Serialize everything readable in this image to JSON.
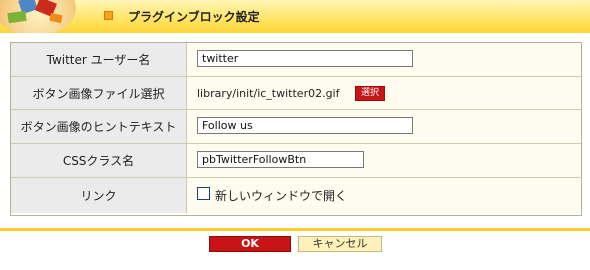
{
  "header": {
    "title": "プラグインブロック設定"
  },
  "form": {
    "rows": [
      {
        "label": "Twitter ユーザー名",
        "value": "twitter"
      },
      {
        "label": "ボタン画像ファイル選択",
        "value": "library/init/ic_twitter02.gif",
        "select_label": "選択"
      },
      {
        "label": "ボタン画像のヒントテキスト",
        "value": "Follow us"
      },
      {
        "label": "CSSクラス名",
        "value": "pbTwitterFollowBtn"
      },
      {
        "label": "リンク",
        "checkbox_label": "新しいウィンドウで開く",
        "checked": false
      }
    ]
  },
  "footer": {
    "ok_label": "OK",
    "cancel_label": "キャンセル"
  },
  "colors": {
    "header_gradient_top": "#fff6b8",
    "header_gradient_bottom": "#ffd436",
    "accent_red": "#c81414",
    "label_bg": "#ebebeb",
    "value_bg": "#fefcef"
  }
}
